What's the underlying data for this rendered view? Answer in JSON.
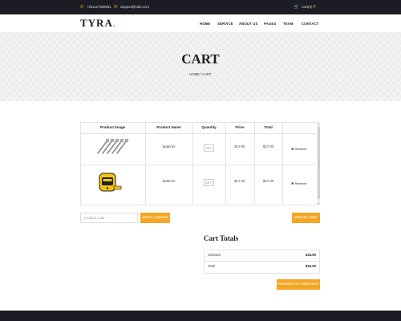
{
  "topbar": {
    "phone": "+351127856981",
    "email": "support@eaib.com",
    "cart": "Cart(0)"
  },
  "header": {
    "logo": "TYRA",
    "logo_dot": ".",
    "nav": [
      "HOME",
      "SERVICE",
      "ABOUT US",
      "PAGES",
      "TEAM",
      "CONTACT"
    ]
  },
  "banner": {
    "title": "CART",
    "breadcrumb": "HOME / CART"
  },
  "cart_table": {
    "headers": [
      "Product Image",
      "Product Name",
      "Quantity",
      "Price",
      "Total"
    ],
    "rows": [
      {
        "image": "wrench-set-image",
        "name": "Spanner",
        "qty": "10",
        "price": "$17.00",
        "total": "$17.00",
        "remove": "✖ Remove"
      },
      {
        "image": "tape-measure-image",
        "name": "Spanner",
        "qty": "10",
        "price": "$17.00",
        "total": "$17.00",
        "remove": "✖ Remove"
      }
    ]
  },
  "coupon": {
    "placeholder": "Coupon code",
    "apply_label": "APPLY COUPON",
    "update_label": "UPDATE CART"
  },
  "totals": {
    "title": "Cart Totals",
    "subtotal_label": "Subtotal",
    "subtotal_value": "$34.00",
    "total_label": "Total",
    "total_value": "$30.00",
    "checkout_label": "PROCEED TO CHECKOUT"
  },
  "colors": {
    "accent": "#f5a623",
    "dark": "#1c1c24"
  }
}
